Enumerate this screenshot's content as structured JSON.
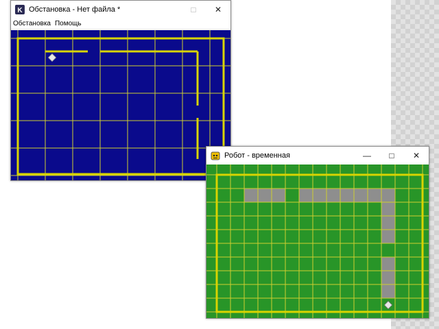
{
  "colors": {
    "setup_background": "#0a0a8c",
    "robot_background": "#289528",
    "grid_line": "#cfcf30",
    "wall": "#d8d400",
    "painted_cell": "#8e8e8e",
    "robot_marker": "#e8e8e8"
  },
  "setup_window": {
    "app_icon": "k-letter-icon",
    "title": "Обстановка - Нет файла *",
    "controls": {
      "minimize": "—",
      "maximize": "□",
      "close": "✕"
    },
    "menu": [
      "Обстановка",
      "Помощь"
    ]
  },
  "robot_window": {
    "app_icon": "robot-face-icon",
    "title": "Робот - временная",
    "controls": {
      "minimize": "—",
      "maximize": "□",
      "close": "✕"
    }
  },
  "field": {
    "columns": 15,
    "rows": 10,
    "robot_cell": [
      12,
      9
    ],
    "painted_cells": [
      [
        2,
        1
      ],
      [
        3,
        1
      ],
      [
        4,
        1
      ],
      [
        6,
        1
      ],
      [
        7,
        1
      ],
      [
        8,
        1
      ],
      [
        9,
        1
      ],
      [
        10,
        1
      ],
      [
        11,
        1
      ],
      [
        12,
        1
      ],
      [
        12,
        2
      ],
      [
        12,
        3
      ],
      [
        12,
        4
      ],
      [
        12,
        6
      ],
      [
        12,
        7
      ],
      [
        12,
        8
      ]
    ]
  }
}
